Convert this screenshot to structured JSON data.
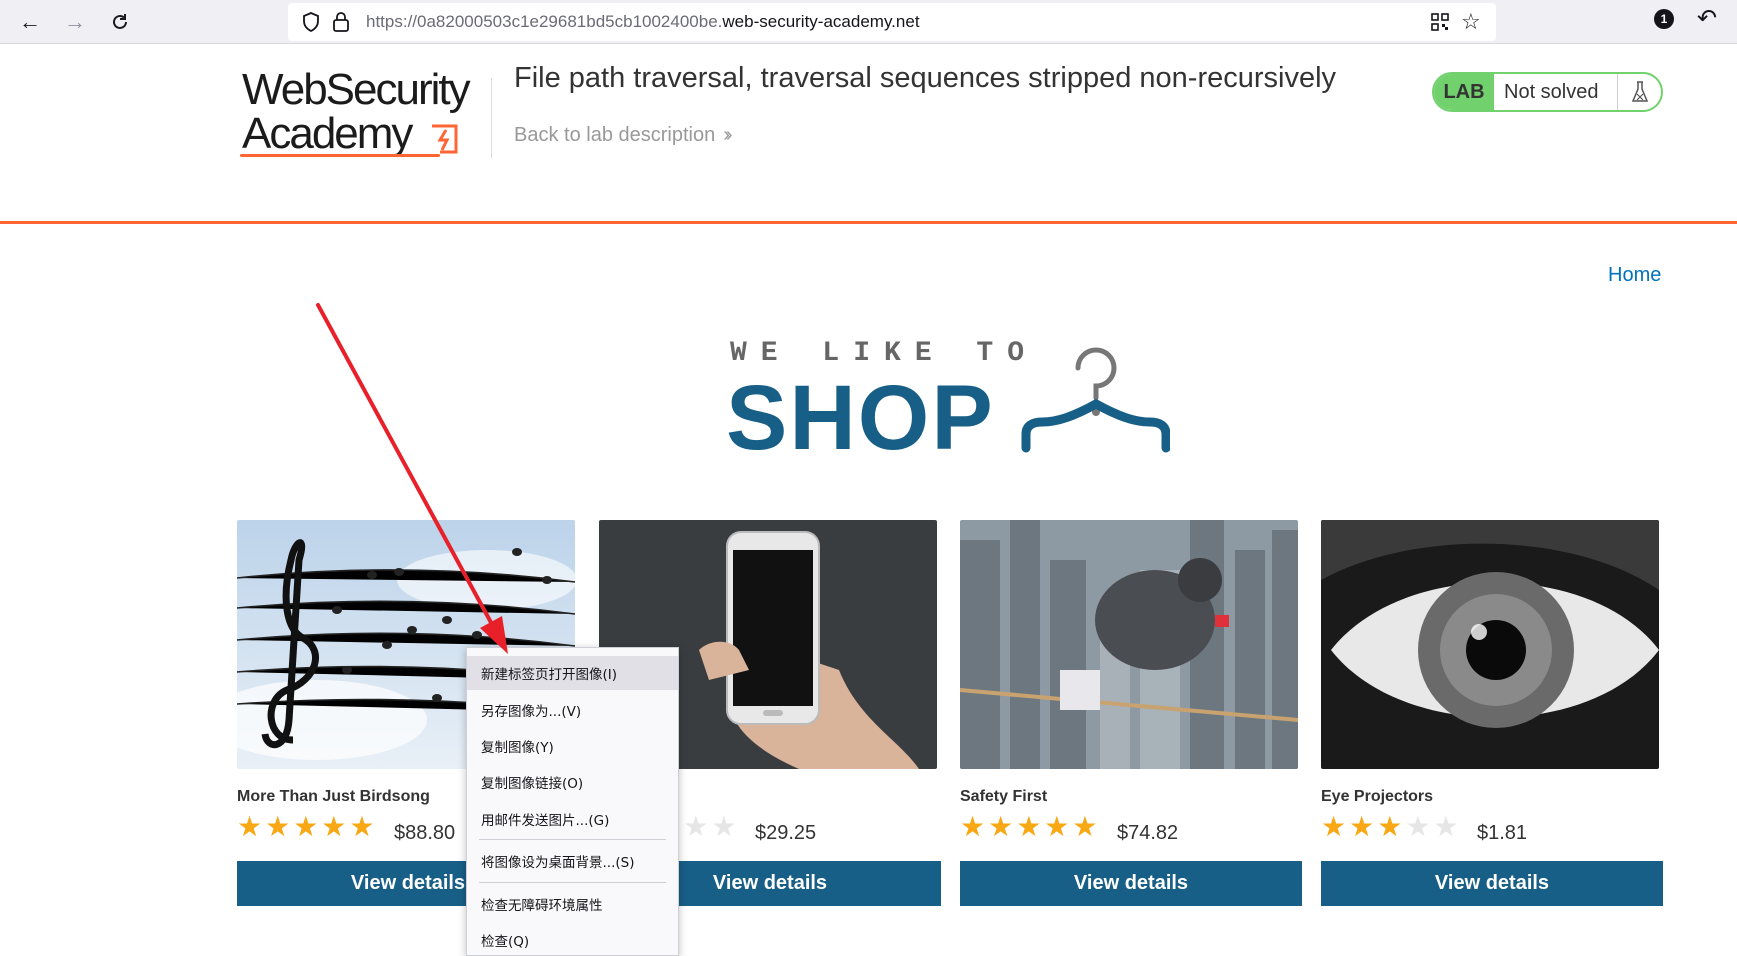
{
  "browser": {
    "url_prefix": "https://0a82000503c1e29681bd5cb1002400be.",
    "url_domain": "web-security-academy.net",
    "extension_badge": "1"
  },
  "lab": {
    "logo_line1": "WebSecurity",
    "logo_line2": "Academy",
    "title": "File path traversal, traversal sequences stripped non-recursively",
    "back_link": "Back to lab description",
    "status_tag": "LAB",
    "status_text": "Not solved"
  },
  "nav": {
    "home": "Home"
  },
  "banner": {
    "top": "WE LIKE TO",
    "main": "SHOP"
  },
  "products": [
    {
      "name": "More Than Just Birdsong",
      "rating": 5,
      "price": "$88.80",
      "button": "View details",
      "image": "music-birds-on-wires"
    },
    {
      "name": "",
      "rating": 2,
      "price": "$29.25",
      "button": "View details",
      "image": "hand-holding-phone"
    },
    {
      "name": "Safety First",
      "rating": 5,
      "price": "$74.82",
      "button": "View details",
      "image": "child-on-tightrope-city"
    },
    {
      "name": "Eye Projectors",
      "rating": 3,
      "price": "$1.81",
      "button": "View details",
      "image": "eye-closeup"
    }
  ],
  "context_menu": {
    "items": [
      "新建标签页打开图像(I)",
      "另存图像为...(V)",
      "复制图像(Y)",
      "复制图像链接(O)",
      "用邮件发送图片...(G)",
      "将图像设为桌面背景...(S)",
      "检查无障碍环境属性",
      "检查(Q)"
    ]
  },
  "colors": {
    "brand_orange": "#ff6633",
    "primary_blue": "#185f87",
    "link_blue": "#0071bc",
    "lab_green": "#70d16d",
    "star": "#f7a814",
    "annotation_red": "#e8202a"
  }
}
